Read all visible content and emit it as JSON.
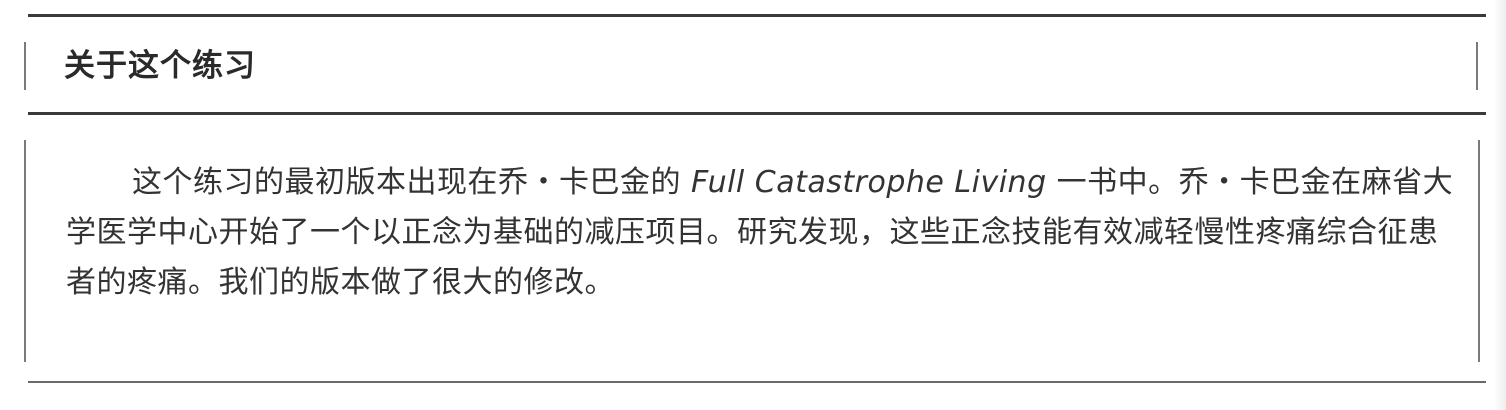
{
  "section": {
    "heading": "关于这个练习"
  },
  "body": {
    "text_before_title": "这个练习的最初版本出现在乔・卡巴金的 ",
    "book_title": "Full Catastrophe Living",
    "text_after_title": " 一书中。乔・卡巴金在麻省大学医学中心开始了一个以正念为基础的减压项目。研究发现，这些正念技能有效减轻慢性疼痛综合征患者的疼痛。我们的版本做了很大的修改。"
  }
}
